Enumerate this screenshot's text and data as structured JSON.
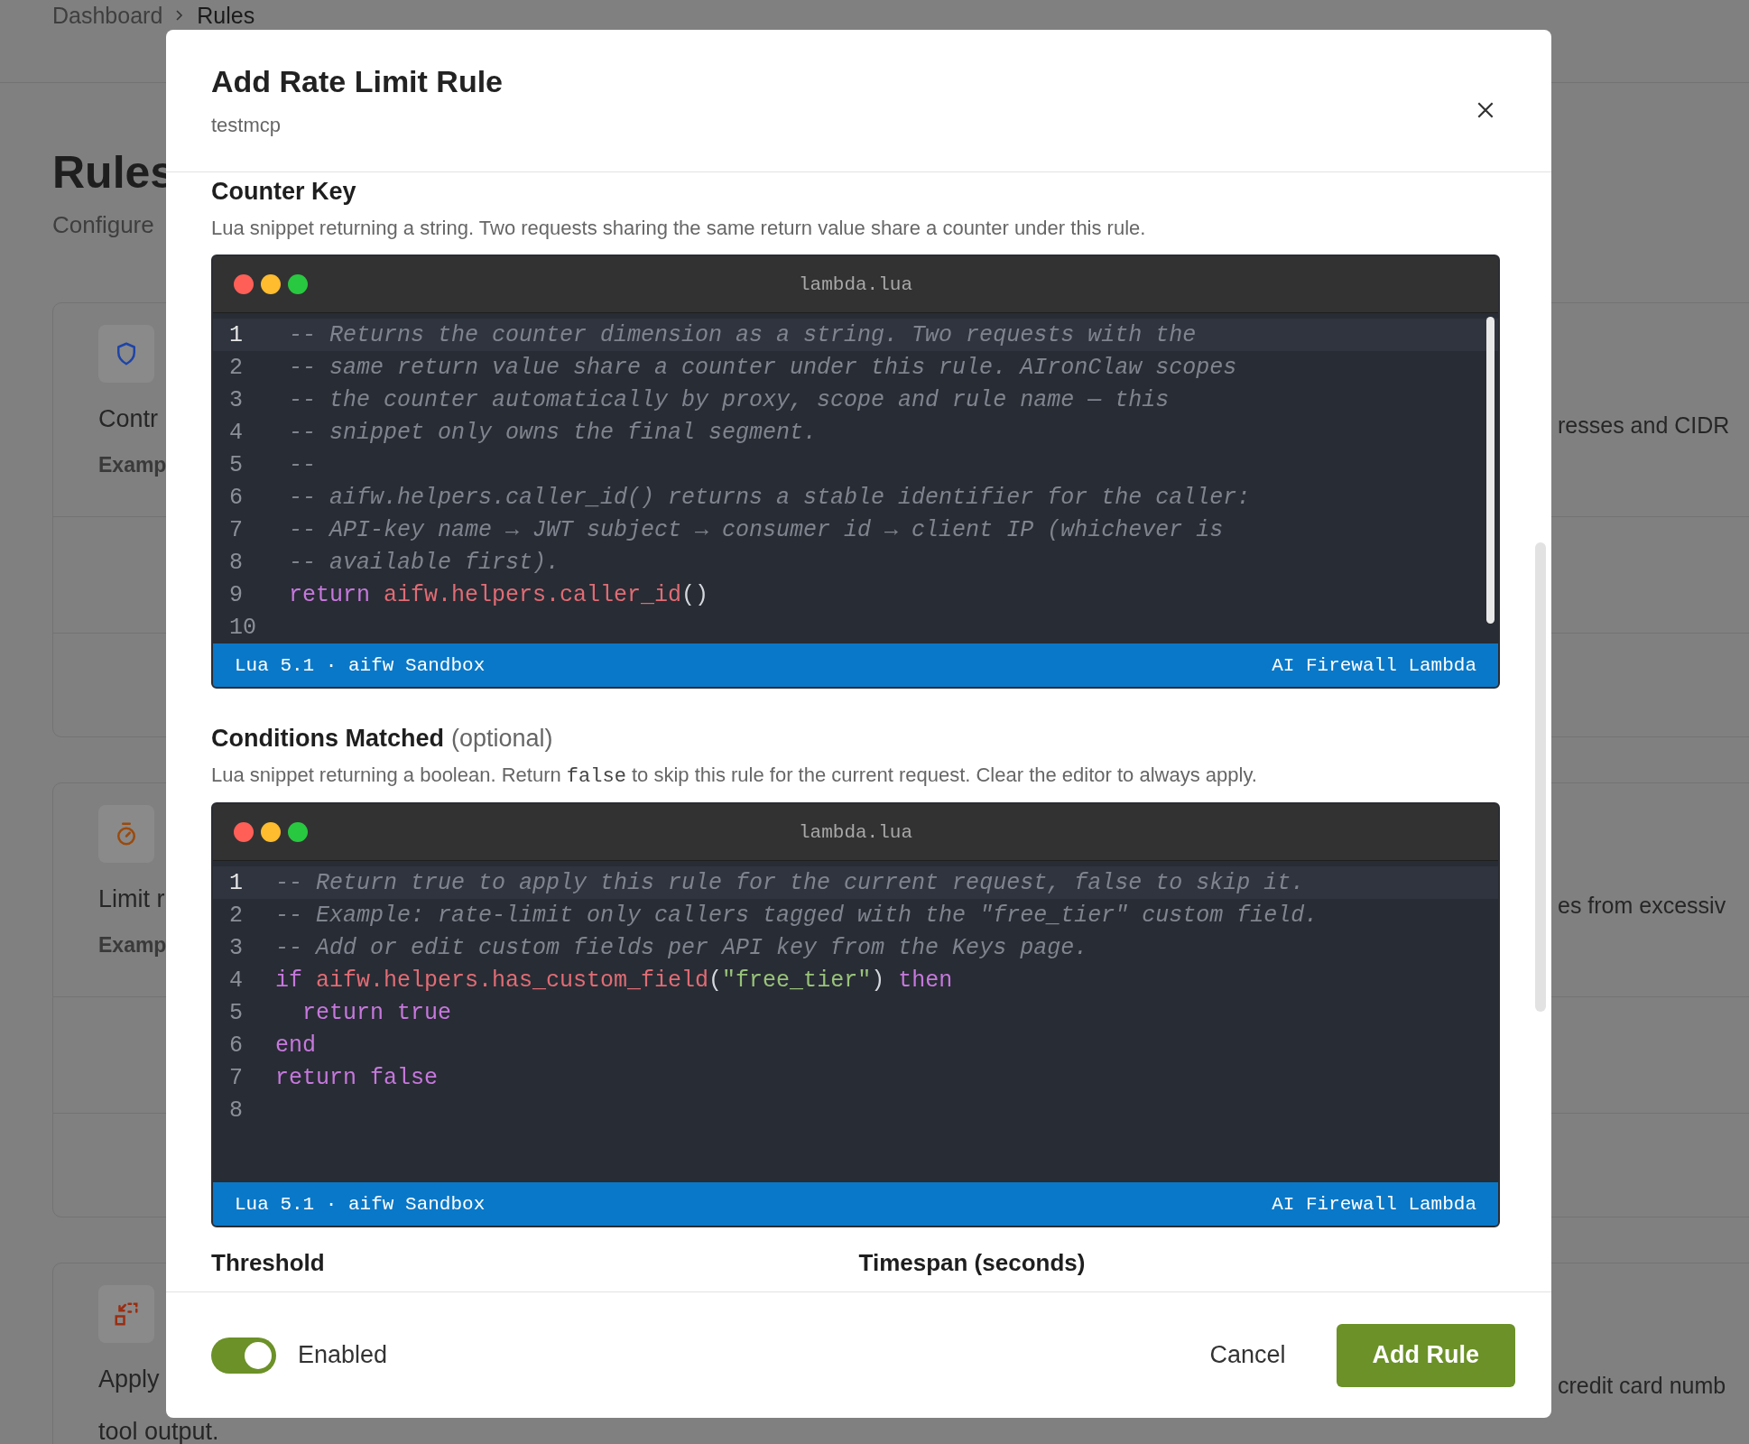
{
  "breadcrumb": [
    {
      "label": "Dashboard"
    },
    {
      "label": "Rules"
    }
  ],
  "page": {
    "title": "Rules",
    "subtitle": "Configure"
  },
  "cards": [
    {
      "kind": "shield",
      "color": "#1e44a8",
      "left_lines": [
        "Contr"
      ],
      "example": "Examp",
      "right_text": "resses and CIDR"
    },
    {
      "kind": "timer",
      "color": "#9a4a0c",
      "left_lines": [
        "Limit r"
      ],
      "example": "Examp",
      "right_text": "es from excessiv"
    },
    {
      "kind": "transform",
      "color": "#9a2e12",
      "left_lines": [
        "Apply",
        "tool output."
      ],
      "right_text": "credit card numb"
    }
  ],
  "modal": {
    "title": "Add Rate Limit Rule",
    "subtitle": "testmcp",
    "sections": [
      {
        "label": "Counter Key",
        "description": [
          {
            "kind": "text",
            "text": "Lua snippet returning a string. Two requests sharing the same return value share a counter under this rule."
          }
        ],
        "editor": {
          "filename": "lambda.lua",
          "status_left": "Lua 5.1 · aifw Sandbox",
          "status_right": "AI Firewall Lambda",
          "lines": [
            {
              "number": "1",
              "active": true,
              "tokens": [
                {
                  "kind": "comment",
                  "text": "-- Returns the counter dimension as a string. Two requests with the"
                }
              ]
            },
            {
              "number": "2",
              "active": false,
              "tokens": [
                {
                  "kind": "comment",
                  "text": "-- same return value share a counter under this rule. AIronClaw scopes"
                }
              ]
            },
            {
              "number": "3",
              "active": false,
              "tokens": [
                {
                  "kind": "comment",
                  "text": "-- the counter automatically by proxy, scope and rule name — this"
                }
              ]
            },
            {
              "number": "4",
              "active": false,
              "tokens": [
                {
                  "kind": "comment",
                  "text": "-- snippet only owns the final segment."
                }
              ]
            },
            {
              "number": "5",
              "active": false,
              "tokens": [
                {
                  "kind": "comment",
                  "text": "--"
                }
              ]
            },
            {
              "number": "6",
              "active": false,
              "tokens": [
                {
                  "kind": "comment",
                  "text": "-- aifw.helpers.caller_id() returns a stable identifier for the caller:"
                }
              ]
            },
            {
              "number": "7",
              "active": false,
              "tokens": [
                {
                  "kind": "comment",
                  "text": "-- API-key name → JWT subject → consumer id → client IP (whichever is"
                }
              ]
            },
            {
              "number": "8",
              "active": false,
              "tokens": [
                {
                  "kind": "comment",
                  "text": "-- available first)."
                }
              ]
            },
            {
              "number": "9",
              "active": false,
              "tokens": [
                {
                  "kind": "keyword",
                  "text": "return "
                },
                {
                  "kind": "function",
                  "text": "aifw.helpers.caller_id"
                },
                {
                  "kind": "plain",
                  "text": "()"
                }
              ]
            },
            {
              "number": "10",
              "active": false
            }
          ]
        }
      },
      {
        "label": "Conditions Matched",
        "hint": "(optional)",
        "description": [
          {
            "kind": "text",
            "text": "Lua snippet returning a boolean. Return "
          },
          {
            "kind": "code",
            "text": "false"
          },
          {
            "kind": "text",
            "text": " to skip this rule for the current request. Clear the editor to always apply."
          }
        ],
        "editor": {
          "filename": "lambda.lua",
          "status_left": "Lua 5.1 · aifw Sandbox",
          "status_right": "AI Firewall Lambda",
          "lines": [
            {
              "number": "1",
              "active": true,
              "tokens": [
                {
                  "kind": "comment",
                  "text": "-- Return true to apply this rule for the current request, false to skip it."
                }
              ]
            },
            {
              "number": "2",
              "active": false,
              "tokens": [
                {
                  "kind": "comment",
                  "text": "-- Example: rate-limit only callers tagged with the \"free_tier\" custom field."
                }
              ]
            },
            {
              "number": "3",
              "active": false,
              "tokens": [
                {
                  "kind": "comment",
                  "text": "-- Add or edit custom fields per API key from the Keys page."
                }
              ]
            },
            {
              "number": "4",
              "active": false,
              "tokens": [
                {
                  "kind": "keyword",
                  "text": "if "
                },
                {
                  "kind": "function",
                  "text": "aifw.helpers.has_custom_field"
                },
                {
                  "kind": "plain",
                  "text": "("
                },
                {
                  "kind": "string",
                  "text": "\"free_tier\""
                },
                {
                  "kind": "plain",
                  "text": ") "
                },
                {
                  "kind": "keyword",
                  "text": "then"
                }
              ]
            },
            {
              "number": "5",
              "active": false,
              "tokens": [
                {
                  "kind": "keyword",
                  "text": "  return true"
                }
              ]
            },
            {
              "number": "6",
              "active": false,
              "tokens": [
                {
                  "kind": "keyword",
                  "text": "end"
                }
              ]
            },
            {
              "number": "7",
              "active": false,
              "tokens": [
                {
                  "kind": "keyword",
                  "text": "return false"
                }
              ]
            },
            {
              "number": "8",
              "active": false
            }
          ]
        }
      }
    ],
    "fields": [
      {
        "label": "Threshold"
      },
      {
        "label": "Timespan (seconds)"
      }
    ],
    "footer": {
      "toggle": {
        "label": "Enabled",
        "on": true
      },
      "buttons": [
        {
          "kind": "secondary",
          "label": "Cancel"
        },
        {
          "kind": "primary",
          "label": "Add Rule"
        }
      ]
    }
  }
}
